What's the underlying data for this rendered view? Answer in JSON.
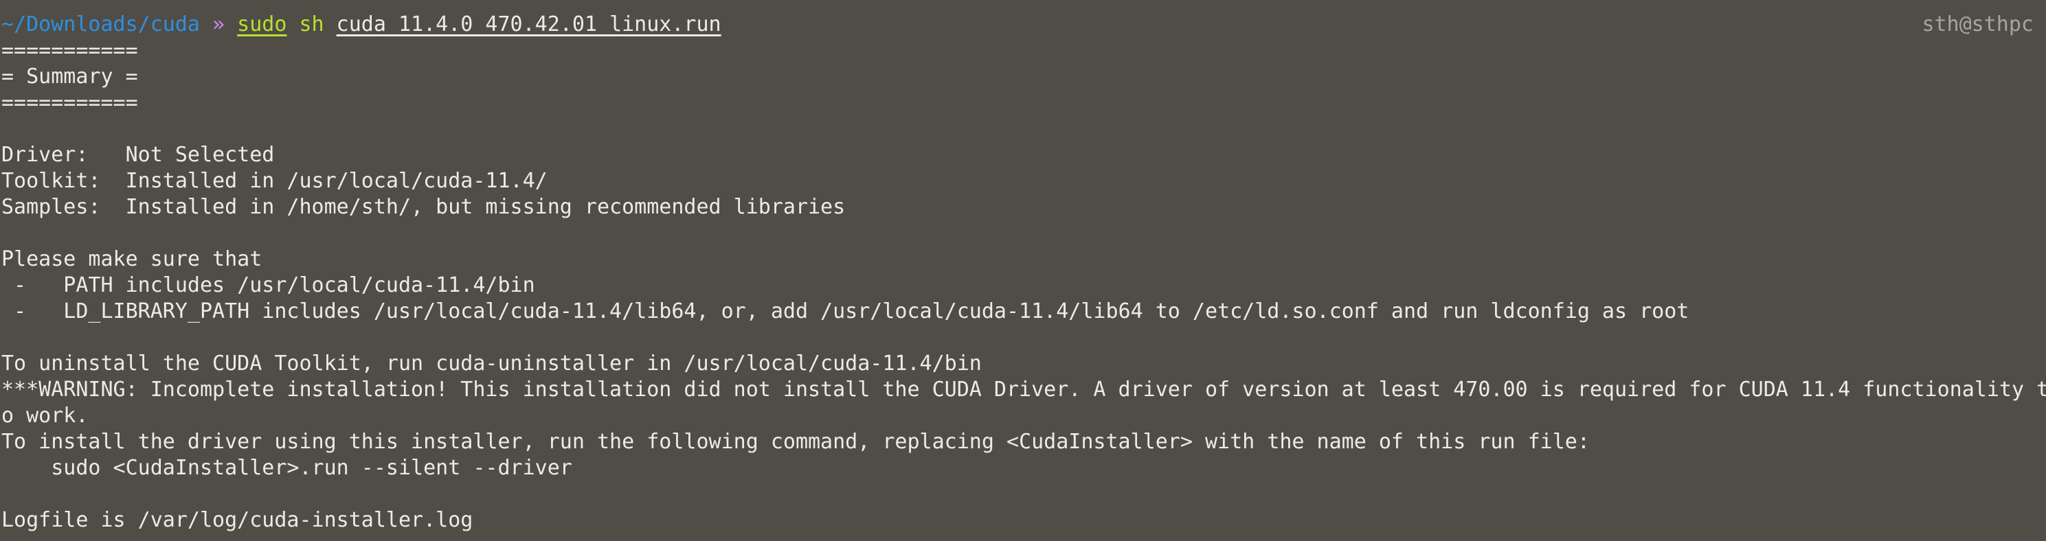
{
  "colors": {
    "background": "#4f4d46",
    "text": "#ecebe6",
    "prompt_path": "#2f8fe0",
    "prompt_arrow": "#c98cf0",
    "command": "#b9e030",
    "right_prompt": "#a7a59d"
  },
  "prompt": {
    "path": "~/Downloads/cuda",
    "arrow": "»",
    "sudo": "sudo",
    "command": "sh",
    "argument": "cuda_11.4.0_470.42.01_linux.run",
    "right": "sth@sthpc"
  },
  "output": [
    "===========",
    "= Summary =",
    "===========",
    "",
    "Driver:   Not Selected",
    "Toolkit:  Installed in /usr/local/cuda-11.4/",
    "Samples:  Installed in /home/sth/, but missing recommended libraries",
    "",
    "Please make sure that",
    " -   PATH includes /usr/local/cuda-11.4/bin",
    " -   LD_LIBRARY_PATH includes /usr/local/cuda-11.4/lib64, or, add /usr/local/cuda-11.4/lib64 to /etc/ld.so.conf and run ldconfig as root",
    "",
    "To uninstall the CUDA Toolkit, run cuda-uninstaller in /usr/local/cuda-11.4/bin",
    "***WARNING: Incomplete installation! This installation did not install the CUDA Driver. A driver of version at least 470.00 is required for CUDA 11.4 functionality t",
    "o work.",
    "To install the driver using this installer, run the following command, replacing <CudaInstaller> with the name of this run file:",
    "    sudo <CudaInstaller>.run --silent --driver",
    "",
    "Logfile is /var/log/cuda-installer.log"
  ]
}
